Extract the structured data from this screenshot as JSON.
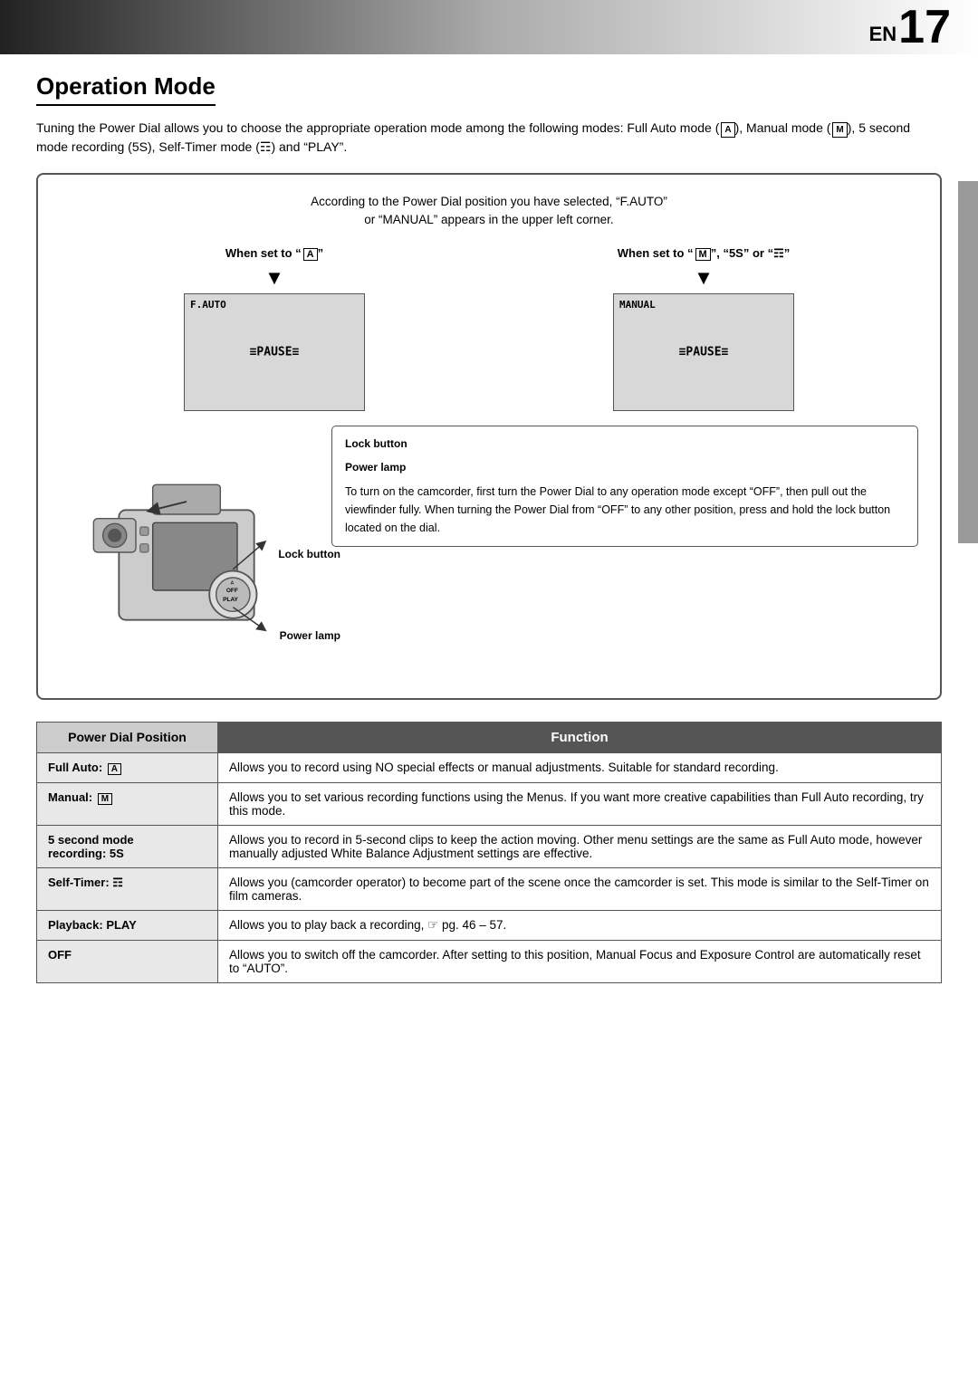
{
  "header": {
    "en_label": "EN",
    "page_number": "17",
    "gradient": "black to white"
  },
  "section": {
    "title": "Operation Mode",
    "intro": "Tuning the Power Dial allows you to choose the appropriate operation mode among the following modes: Full Auto mode (■), Manual mode (■), 5 second mode recording (5S), Self-Timer mode (↺) and “PLAY”."
  },
  "diagram": {
    "caption_line1": "According to the Power Dial position you have selected, “F.AUTO”",
    "caption_line2": "or “MANUAL” appears in the upper left corner.",
    "screen_left": {
      "when_label": "When set to “■”",
      "mode_text": "F.AUTO",
      "pause_text": "≡PAUSE≡"
    },
    "screen_right": {
      "when_label": "When set to “■”, “5S” or “↺”",
      "mode_text": "MANUAL",
      "pause_text": "≡PAUSE≡"
    },
    "lock_button_label": "Lock button",
    "power_lamp_label": "Power lamp",
    "info_text": "To turn on the camcorder, first turn the Power Dial to any operation mode except “OFF”,  then pull out the viewfinder fully. When turning the Power Dial from “OFF” to any other position, press and hold the lock button located on the dial."
  },
  "table": {
    "col1_header": "Power Dial Position",
    "col2_header": "Function",
    "rows": [
      {
        "position": "Full Auto: ■",
        "function": "Allows you to record using NO special effects or manual adjustments. Suitable for standard recording."
      },
      {
        "position": "Manual: ■",
        "function": "Allows you to set various recording functions using the Menus. If you want more creative capabilities than Full Auto recording, try this mode."
      },
      {
        "position": "5 second mode recording: 5S",
        "function": "Allows you to record in 5-second clips to keep the action moving. Other menu settings are the same as Full Auto mode, however manually adjusted White Balance Adjustment settings are effective."
      },
      {
        "position": "Self-Timer: ↺",
        "function": "Allows you (camcorder operator) to become part of the scene once the camcorder is set. This mode is similar to the Self-Timer on film cameras."
      },
      {
        "position": "Playback: PLAY",
        "function": "Allows you to play back a recording, ☞ pg. 46 – 57."
      },
      {
        "position": "OFF",
        "function": "Allows you to switch off the camcorder. After setting to this position, Manual Focus and Exposure Control are automatically reset to “AUTO”."
      }
    ]
  }
}
